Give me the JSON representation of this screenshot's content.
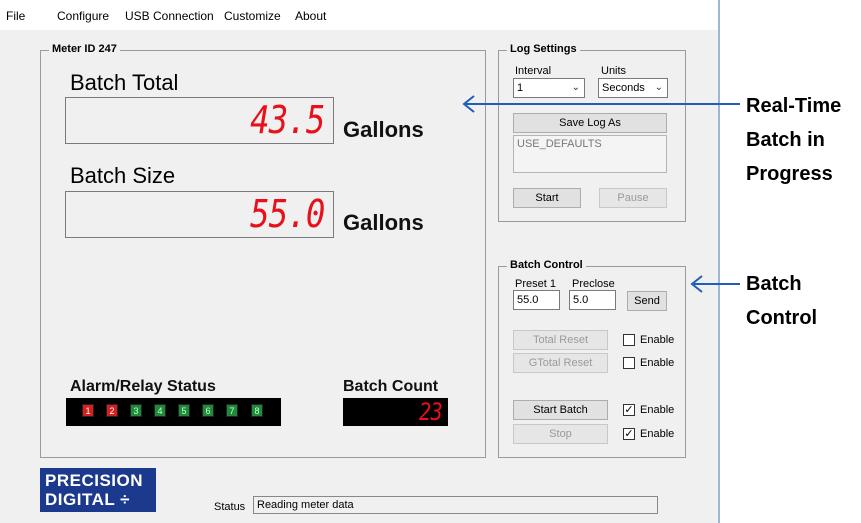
{
  "menu": [
    "File",
    "Configure",
    "USB Connection",
    "Customize",
    "About"
  ],
  "meter": {
    "title": "Meter ID 247",
    "batch_total_label": "Batch Total",
    "batch_total_value": "43.5",
    "batch_total_unit": "Gallons",
    "batch_size_label": "Batch Size",
    "batch_size_value": "55.0",
    "batch_size_unit": "Gallons",
    "alarm_label": "Alarm/Relay Status",
    "relays": [
      "1",
      "2",
      "3",
      "4",
      "5",
      "6",
      "7",
      "8"
    ],
    "batch_count_label": "Batch Count",
    "batch_count_value": "23"
  },
  "log_settings": {
    "title": "Log Settings",
    "interval_label": "Interval",
    "interval_value": "1",
    "units_label": "Units",
    "units_value": "Seconds",
    "save_label": "Save Log As",
    "log_text": "USE_DEFAULTS",
    "start_label": "Start",
    "pause_label": "Pause"
  },
  "batch_control": {
    "title": "Batch Control",
    "preset_label": "Preset 1",
    "preset_value": "55.0",
    "preclose_label": "Preclose",
    "preclose_value": "5.0",
    "send_label": "Send",
    "total_reset_label": "Total Reset",
    "gtotal_reset_label": "GTotal Reset",
    "start_batch_label": "Start Batch",
    "stop_label": "Stop",
    "enable_label": "Enable"
  },
  "logo": {
    "line1": "PRECISION",
    "line2": "DIGITAL ÷"
  },
  "status": {
    "label": "Status",
    "text": "Reading meter data"
  },
  "annotations": {
    "realtime": [
      "Real-Time",
      "Batch in",
      "Progress"
    ],
    "batch_control": [
      "Batch",
      "Control"
    ]
  },
  "colors": {
    "segment_red": "#e8101a",
    "relay_red": "#d61f1f",
    "relay_green": "#1f8b3a",
    "logo_blue": "#1b3a8e",
    "annotation_arrow": "#1f5fb5"
  }
}
